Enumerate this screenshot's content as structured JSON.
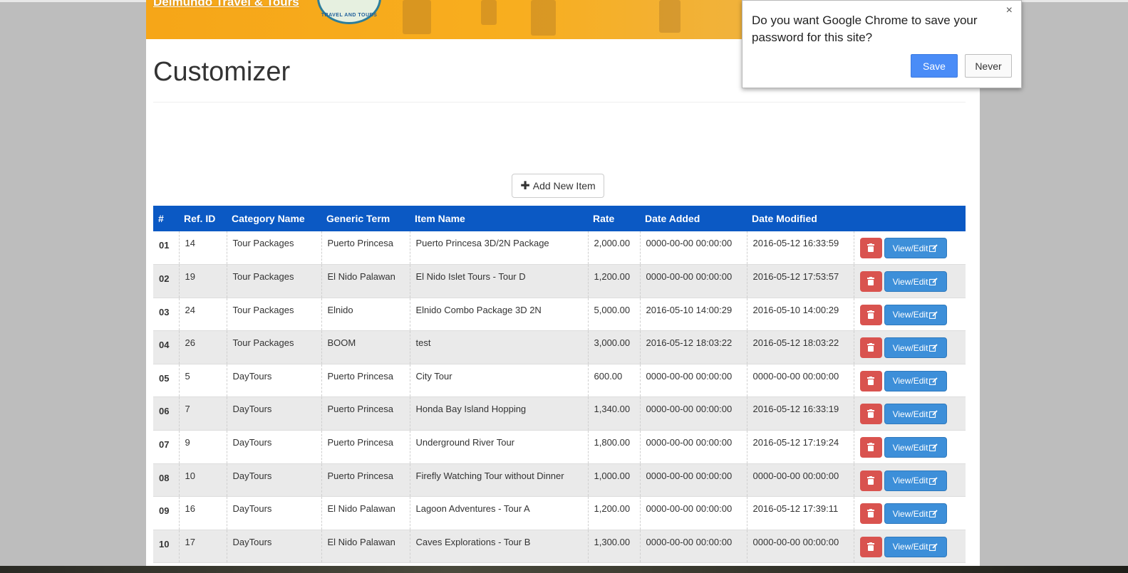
{
  "banner": {
    "brand": "Delmundo Travel & Tours",
    "logo_text": "TRAVEL AND TOURS"
  },
  "page": {
    "title": "Customizer"
  },
  "toolbar": {
    "add_label": "Add New Item"
  },
  "table": {
    "headers": [
      "#",
      "Ref. ID",
      "Category Name",
      "Generic Term",
      "Item Name",
      "Rate",
      "Date Added",
      "Date Modified",
      ""
    ],
    "edit_label": "View/Edit",
    "rows": [
      {
        "num": "01",
        "ref": "14",
        "category": "Tour Packages",
        "generic": "Puerto Princesa",
        "item": "Puerto Princesa 3D/2N Package",
        "rate": "2,000.00",
        "added": "0000-00-00 00:00:00",
        "modified": "2016-05-12 16:33:59"
      },
      {
        "num": "02",
        "ref": "19",
        "category": "Tour Packages",
        "generic": "El Nido Palawan",
        "item": "El Nido Islet Tours - Tour D",
        "rate": "1,200.00",
        "added": "0000-00-00 00:00:00",
        "modified": "2016-05-12 17:53:57"
      },
      {
        "num": "03",
        "ref": "24",
        "category": "Tour Packages",
        "generic": "Elnido",
        "item": "Elnido Combo Package 3D 2N",
        "rate": "5,000.00",
        "added": "2016-05-10 14:00:29",
        "modified": "2016-05-10 14:00:29"
      },
      {
        "num": "04",
        "ref": "26",
        "category": "Tour Packages",
        "generic": "BOOM",
        "item": "test",
        "rate": "3,000.00",
        "added": "2016-05-12 18:03:22",
        "modified": "2016-05-12 18:03:22"
      },
      {
        "num": "05",
        "ref": "5",
        "category": "DayTours",
        "generic": "Puerto Princesa",
        "item": "City Tour",
        "rate": "600.00",
        "added": "0000-00-00 00:00:00",
        "modified": "0000-00-00 00:00:00"
      },
      {
        "num": "06",
        "ref": "7",
        "category": "DayTours",
        "generic": "Puerto Princesa",
        "item": "Honda Bay Island Hopping",
        "rate": "1,340.00",
        "added": "0000-00-00 00:00:00",
        "modified": "2016-05-12 16:33:19"
      },
      {
        "num": "07",
        "ref": "9",
        "category": "DayTours",
        "generic": "Puerto Princesa",
        "item": "Underground River Tour",
        "rate": "1,800.00",
        "added": "0000-00-00 00:00:00",
        "modified": "2016-05-12 17:19:24"
      },
      {
        "num": "08",
        "ref": "10",
        "category": "DayTours",
        "generic": "Puerto Princesa",
        "item": "Firefly Watching Tour without Dinner",
        "rate": "1,000.00",
        "added": "0000-00-00 00:00:00",
        "modified": "0000-00-00 00:00:00"
      },
      {
        "num": "09",
        "ref": "16",
        "category": "DayTours",
        "generic": "El Nido Palawan",
        "item": "Lagoon Adventures - Tour A",
        "rate": "1,200.00",
        "added": "0000-00-00 00:00:00",
        "modified": "2016-05-12 17:39:11"
      },
      {
        "num": "10",
        "ref": "17",
        "category": "DayTours",
        "generic": "El Nido Palawan",
        "item": "Caves Explorations - Tour B",
        "rate": "1,300.00",
        "added": "0000-00-00 00:00:00",
        "modified": "0000-00-00 00:00:00"
      }
    ]
  },
  "password_prompt": {
    "message": "Do you want Google Chrome to save your password for this site?",
    "save_label": "Save",
    "never_label": "Never",
    "close_glyph": "×"
  }
}
